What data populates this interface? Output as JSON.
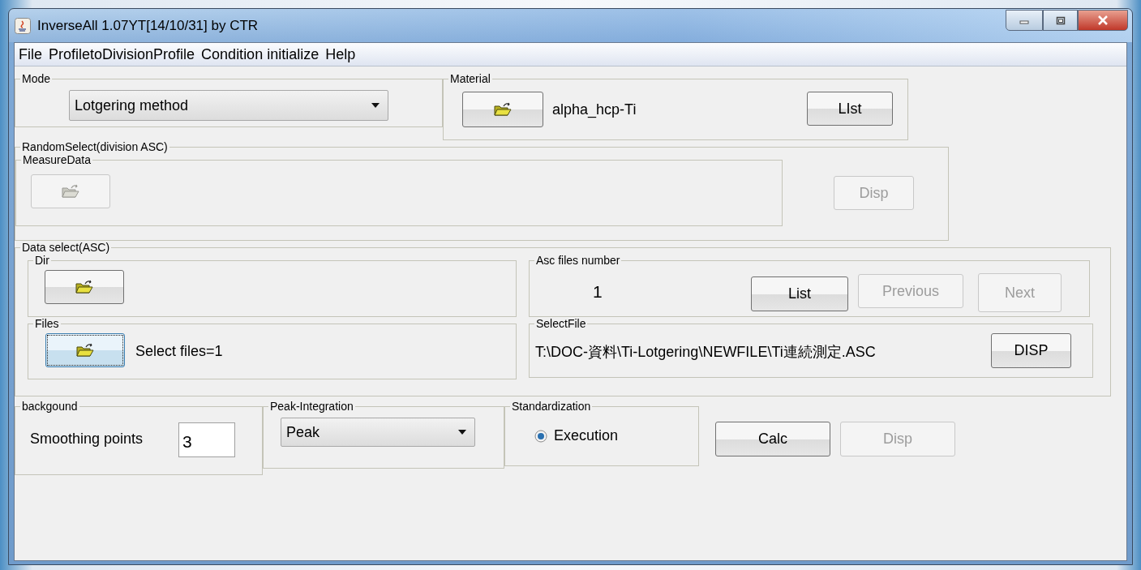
{
  "window": {
    "title": "InverseAll 1.07YT[14/10/31] by CTR"
  },
  "menu": [
    {
      "label": "File"
    },
    {
      "label": "ProfiletoDivisionProfile"
    },
    {
      "label": "Condition initialize"
    },
    {
      "label": "Help"
    }
  ],
  "mode": {
    "legend": "Mode",
    "value": "Lotgering method"
  },
  "material": {
    "legend": "Material",
    "name": "alpha_hcp-Ti",
    "button": "LIst"
  },
  "random_select": {
    "legend": "RandomSelect(division ASC)",
    "measure_data": {
      "legend": "MeasureData",
      "disabled": true
    },
    "disp": {
      "label": "Disp",
      "disabled": true
    }
  },
  "data_select": {
    "legend": "Data select(ASC)",
    "dir": {
      "legend": "Dir",
      "focused": false
    },
    "files": {
      "legend": "Files",
      "focused": true,
      "summary": "Select files=1"
    },
    "asc_files_number": {
      "legend": "Asc files number",
      "value": "1",
      "buttons": [
        {
          "label": "List",
          "disabled": false
        },
        {
          "label": "Previous",
          "disabled": true
        },
        {
          "label": "Next",
          "disabled": true
        }
      ]
    },
    "select_file": {
      "legend": "SelectFile",
      "path": "T:\\DOC-資料\\Ti-Lotgering\\NEWFILE\\Ti連続測定.ASC",
      "button": "DISP"
    }
  },
  "background": {
    "legend": "backgound",
    "label": "Smoothing points",
    "value": "3"
  },
  "peak_integration": {
    "legend": "Peak-Integration",
    "value": "Peak"
  },
  "standardization": {
    "legend": "Standardization",
    "option": "Execution",
    "selected": true
  },
  "actions": [
    {
      "label": "Calc",
      "disabled": false
    },
    {
      "label": "Disp",
      "disabled": true
    }
  ]
}
